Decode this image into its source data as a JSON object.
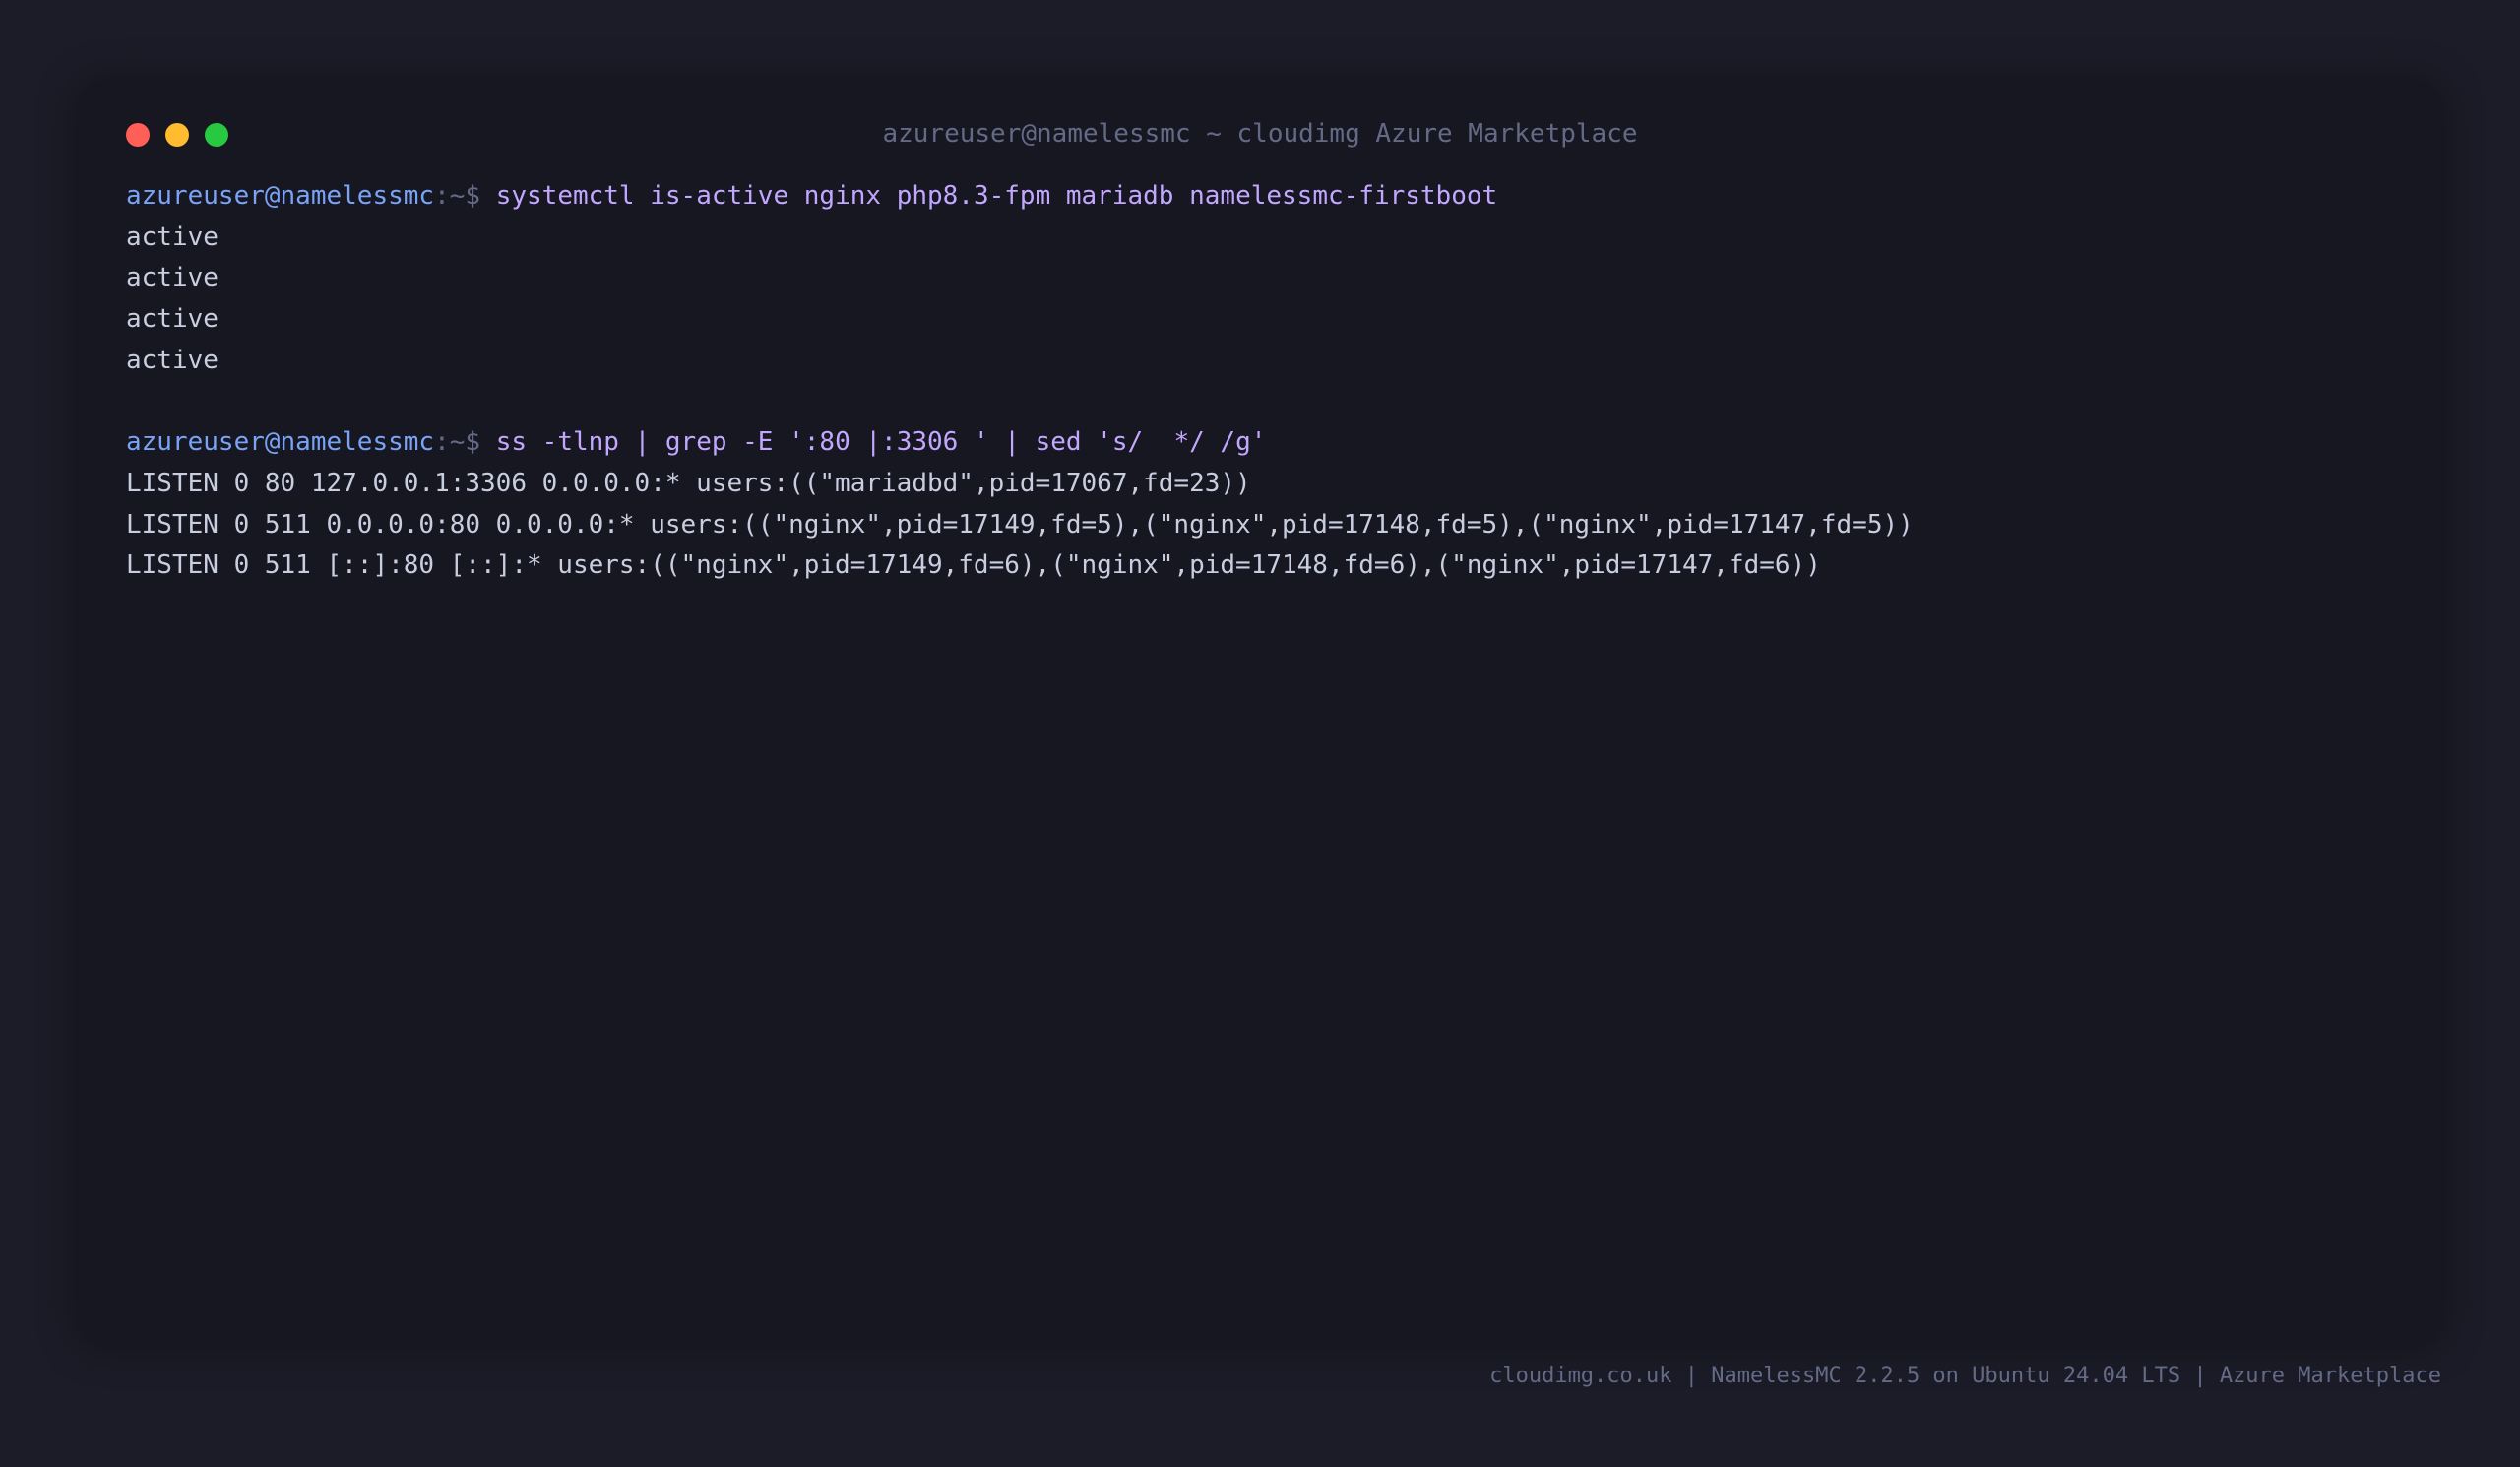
{
  "window": {
    "title": "azureuser@namelessmc ~ cloudimg Azure Marketplace",
    "controls": {
      "close_color": "#ff5f57",
      "minimize_color": "#febc2e",
      "maximize_color": "#28c840"
    }
  },
  "terminal": {
    "commands": [
      {
        "user": "azureuser@namelessmc",
        "prompt": ":~$ ",
        "command": "systemctl is-active nginx php8.3-fpm mariadb namelessmc-firstboot",
        "output": [
          "active",
          "active",
          "active",
          "active"
        ]
      },
      {
        "user": "azureuser@namelessmc",
        "prompt": ":~$ ",
        "command": "ss -tlnp | grep -E ':80 |:3306 ' | sed 's/  */ /g'",
        "output": [
          "LISTEN 0 80 127.0.0.1:3306 0.0.0.0:* users:((\"mariadbd\",pid=17067,fd=23))",
          "LISTEN 0 511 0.0.0.0:80 0.0.0.0:* users:((\"nginx\",pid=17149,fd=5),(\"nginx\",pid=17148,fd=5),(\"nginx\",pid=17147,fd=5))",
          "LISTEN 0 511 [::]:80 [::]:* users:((\"nginx\",pid=17149,fd=6),(\"nginx\",pid=17148,fd=6),(\"nginx\",pid=17147,fd=6))"
        ]
      }
    ]
  },
  "footer": {
    "text": "cloudimg.co.uk | NamelessMC 2.2.5 on Ubuntu 24.04 LTS | Azure Marketplace"
  },
  "colors": {
    "background": "#1b1c27",
    "window": "#161720",
    "prompt_user": "#7aa2f7",
    "command": "#c3a6ff",
    "output": "#c8cde0",
    "muted": "#646a86"
  }
}
